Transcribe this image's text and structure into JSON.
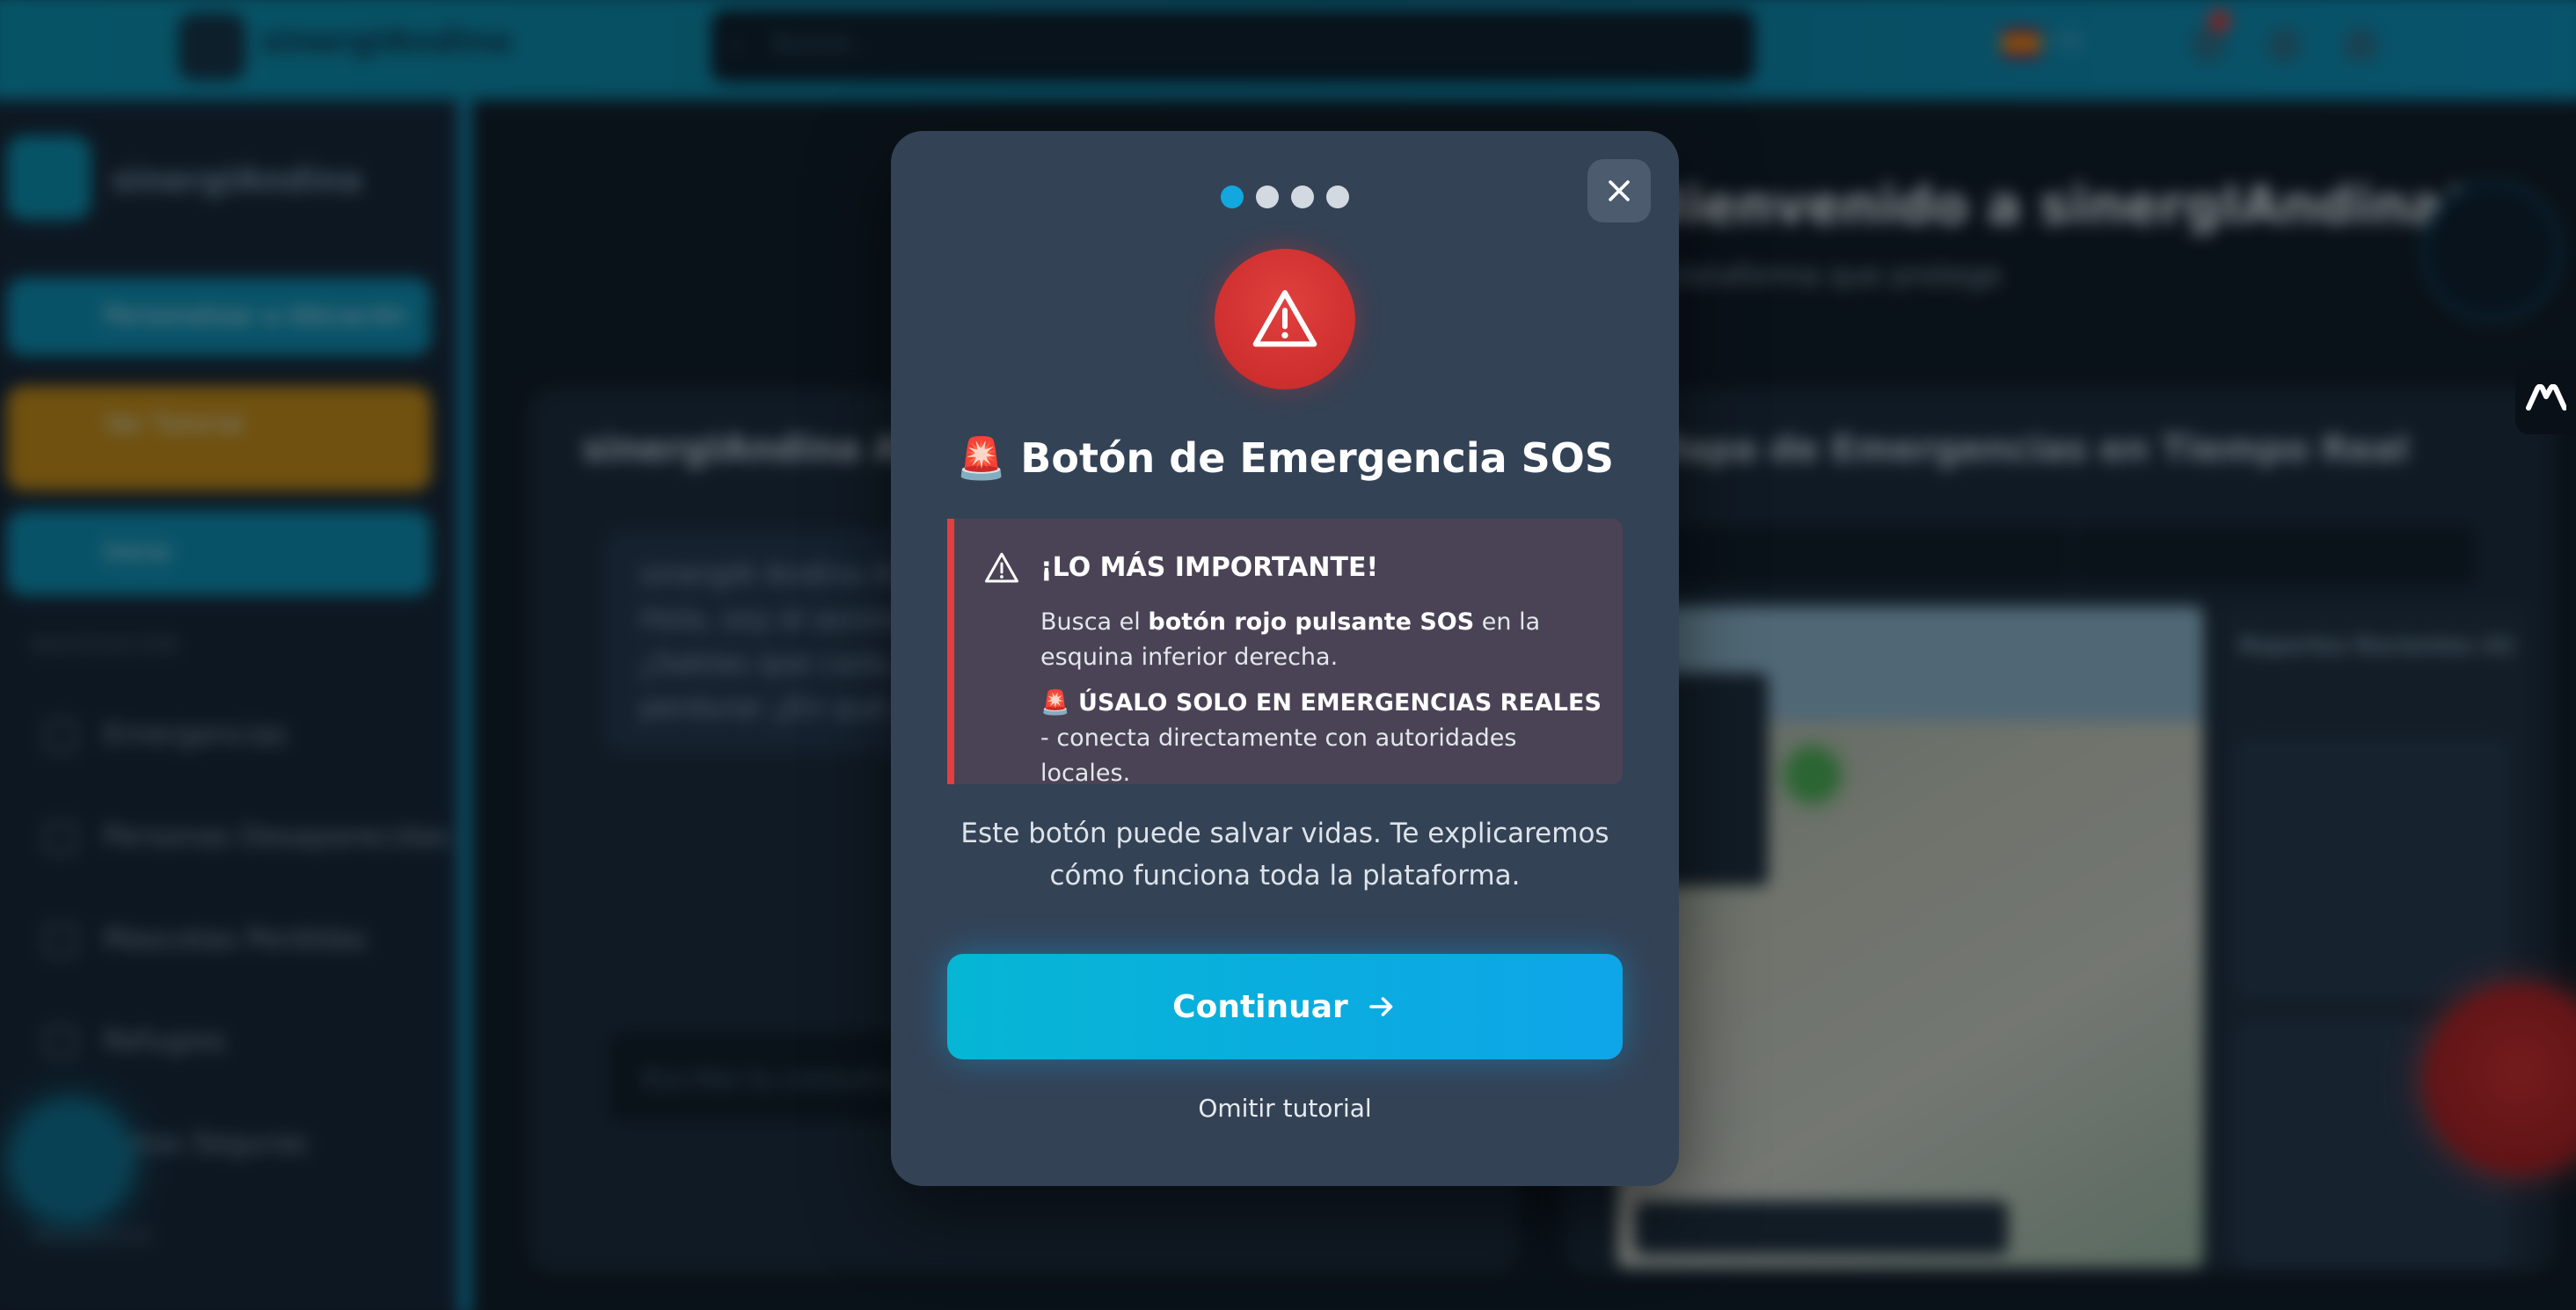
{
  "background": {
    "brand": "sinergIAndina",
    "search_placeholder": "Buscar...",
    "language": "ES",
    "sidebar": {
      "brand": "sinergIAndina",
      "buttons": [
        "Personalizar a Ubicación",
        "Ver Tutorial",
        "Inicio"
      ],
      "section_navigation": "NAVEGACIÓN",
      "items": [
        "Emergencias",
        "Personas Desaparecidas",
        "Mascotas Perdidas",
        "Refugios",
        "Rutas Seguras"
      ],
      "section_resources": "RECURSOS"
    },
    "main": {
      "title": "¡Bienvenido a sinergIAndina!",
      "subtitle": "La plataforma que protege",
      "left_card_title": "sinergIAndina AI",
      "chat_lines": [
        "sinergIA Andina AI",
        "Hola, soy el asistente...",
        "¿Sabías que cada...",
        "perdurar ¿En qué pu..."
      ],
      "chat_placeholder": "Escribe tu consulta...",
      "right_card_title": "Mapa de Emergencias en Tiempo Real",
      "reports_title": "Reportes Recientes (4)"
    }
  },
  "modal": {
    "steps": 4,
    "active_step": 1,
    "title": "🚨 Botón de Emergencia SOS",
    "alert": {
      "heading": "¡LO MÁS IMPORTANTE!",
      "p1_prefix": "Busca el ",
      "p1_bold": "botón rojo pulsante SOS",
      "p1_suffix": " en la esquina inferior derecha.",
      "p2_bold": "🚨 ÚSALO SOLO EN EMERGENCIAS REALES",
      "p2_suffix": " - conecta directamente con autoridades locales."
    },
    "description": "Este botón puede salvar vidas. Te explicaremos cómo funciona toda la plataforma.",
    "continue_label": "Continuar",
    "skip_label": "Omitir tutorial"
  },
  "colors": {
    "accent": "#0ea5e9",
    "danger": "#e53e3e",
    "modal_bg": "#344255"
  }
}
